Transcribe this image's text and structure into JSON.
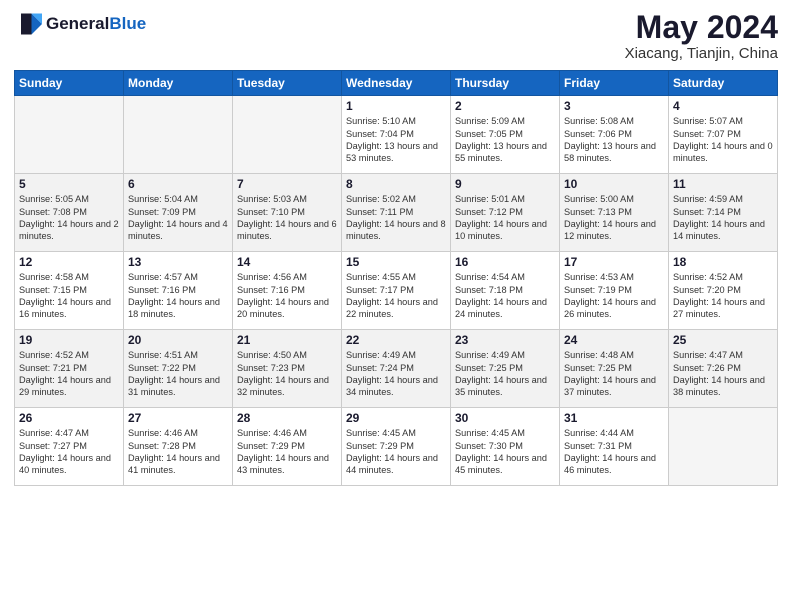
{
  "header": {
    "logo_general": "General",
    "logo_blue": "Blue",
    "month": "May 2024",
    "location": "Xiacang, Tianjin, China"
  },
  "weekdays": [
    "Sunday",
    "Monday",
    "Tuesday",
    "Wednesday",
    "Thursday",
    "Friday",
    "Saturday"
  ],
  "weeks": [
    [
      {
        "day": "",
        "info": ""
      },
      {
        "day": "",
        "info": ""
      },
      {
        "day": "",
        "info": ""
      },
      {
        "day": "1",
        "info": "Sunrise: 5:10 AM\nSunset: 7:04 PM\nDaylight: 13 hours and 53 minutes."
      },
      {
        "day": "2",
        "info": "Sunrise: 5:09 AM\nSunset: 7:05 PM\nDaylight: 13 hours and 55 minutes."
      },
      {
        "day": "3",
        "info": "Sunrise: 5:08 AM\nSunset: 7:06 PM\nDaylight: 13 hours and 58 minutes."
      },
      {
        "day": "4",
        "info": "Sunrise: 5:07 AM\nSunset: 7:07 PM\nDaylight: 14 hours and 0 minutes."
      }
    ],
    [
      {
        "day": "5",
        "info": "Sunrise: 5:05 AM\nSunset: 7:08 PM\nDaylight: 14 hours and 2 minutes."
      },
      {
        "day": "6",
        "info": "Sunrise: 5:04 AM\nSunset: 7:09 PM\nDaylight: 14 hours and 4 minutes."
      },
      {
        "day": "7",
        "info": "Sunrise: 5:03 AM\nSunset: 7:10 PM\nDaylight: 14 hours and 6 minutes."
      },
      {
        "day": "8",
        "info": "Sunrise: 5:02 AM\nSunset: 7:11 PM\nDaylight: 14 hours and 8 minutes."
      },
      {
        "day": "9",
        "info": "Sunrise: 5:01 AM\nSunset: 7:12 PM\nDaylight: 14 hours and 10 minutes."
      },
      {
        "day": "10",
        "info": "Sunrise: 5:00 AM\nSunset: 7:13 PM\nDaylight: 14 hours and 12 minutes."
      },
      {
        "day": "11",
        "info": "Sunrise: 4:59 AM\nSunset: 7:14 PM\nDaylight: 14 hours and 14 minutes."
      }
    ],
    [
      {
        "day": "12",
        "info": "Sunrise: 4:58 AM\nSunset: 7:15 PM\nDaylight: 14 hours and 16 minutes."
      },
      {
        "day": "13",
        "info": "Sunrise: 4:57 AM\nSunset: 7:16 PM\nDaylight: 14 hours and 18 minutes."
      },
      {
        "day": "14",
        "info": "Sunrise: 4:56 AM\nSunset: 7:16 PM\nDaylight: 14 hours and 20 minutes."
      },
      {
        "day": "15",
        "info": "Sunrise: 4:55 AM\nSunset: 7:17 PM\nDaylight: 14 hours and 22 minutes."
      },
      {
        "day": "16",
        "info": "Sunrise: 4:54 AM\nSunset: 7:18 PM\nDaylight: 14 hours and 24 minutes."
      },
      {
        "day": "17",
        "info": "Sunrise: 4:53 AM\nSunset: 7:19 PM\nDaylight: 14 hours and 26 minutes."
      },
      {
        "day": "18",
        "info": "Sunrise: 4:52 AM\nSunset: 7:20 PM\nDaylight: 14 hours and 27 minutes."
      }
    ],
    [
      {
        "day": "19",
        "info": "Sunrise: 4:52 AM\nSunset: 7:21 PM\nDaylight: 14 hours and 29 minutes."
      },
      {
        "day": "20",
        "info": "Sunrise: 4:51 AM\nSunset: 7:22 PM\nDaylight: 14 hours and 31 minutes."
      },
      {
        "day": "21",
        "info": "Sunrise: 4:50 AM\nSunset: 7:23 PM\nDaylight: 14 hours and 32 minutes."
      },
      {
        "day": "22",
        "info": "Sunrise: 4:49 AM\nSunset: 7:24 PM\nDaylight: 14 hours and 34 minutes."
      },
      {
        "day": "23",
        "info": "Sunrise: 4:49 AM\nSunset: 7:25 PM\nDaylight: 14 hours and 35 minutes."
      },
      {
        "day": "24",
        "info": "Sunrise: 4:48 AM\nSunset: 7:25 PM\nDaylight: 14 hours and 37 minutes."
      },
      {
        "day": "25",
        "info": "Sunrise: 4:47 AM\nSunset: 7:26 PM\nDaylight: 14 hours and 38 minutes."
      }
    ],
    [
      {
        "day": "26",
        "info": "Sunrise: 4:47 AM\nSunset: 7:27 PM\nDaylight: 14 hours and 40 minutes."
      },
      {
        "day": "27",
        "info": "Sunrise: 4:46 AM\nSunset: 7:28 PM\nDaylight: 14 hours and 41 minutes."
      },
      {
        "day": "28",
        "info": "Sunrise: 4:46 AM\nSunset: 7:29 PM\nDaylight: 14 hours and 43 minutes."
      },
      {
        "day": "29",
        "info": "Sunrise: 4:45 AM\nSunset: 7:29 PM\nDaylight: 14 hours and 44 minutes."
      },
      {
        "day": "30",
        "info": "Sunrise: 4:45 AM\nSunset: 7:30 PM\nDaylight: 14 hours and 45 minutes."
      },
      {
        "day": "31",
        "info": "Sunrise: 4:44 AM\nSunset: 7:31 PM\nDaylight: 14 hours and 46 minutes."
      },
      {
        "day": "",
        "info": ""
      }
    ]
  ]
}
